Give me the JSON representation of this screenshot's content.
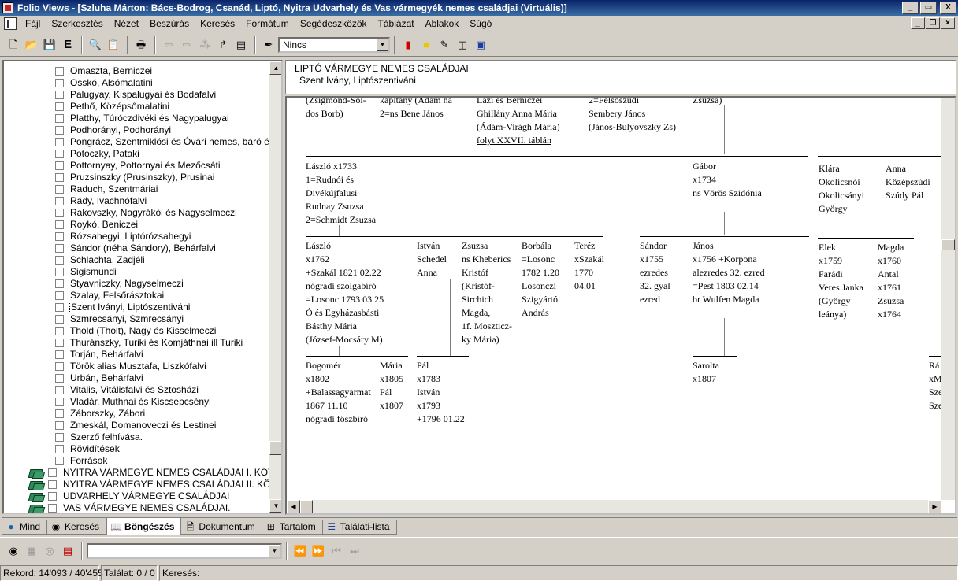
{
  "window": {
    "title": "Folio Views - [Szluha Márton: Bács-Bodrog, Csanád, Liptó, Nyitra Udvarhely és Vas vármegyék nemes családjai (Virtuális)]",
    "minimize": "_",
    "maximize": "▭",
    "close": "X"
  },
  "menu": [
    "Fájl",
    "Szerkesztés",
    "Nézet",
    "Beszúrás",
    "Keresés",
    "Formátum",
    "Segédeszközök",
    "Táblázat",
    "Ablakok",
    "Súgó"
  ],
  "toolbar": {
    "style_combo": "Nincs",
    "icons": [
      "new-doc-icon",
      "open-folder-icon",
      "save-icon",
      "edit-e-icon",
      "search-doc-icon",
      "query-icon",
      "print-icon",
      "back-arrow-icon",
      "forward-arrow-icon",
      "network-icon",
      "jump-icon",
      "object-icon",
      "bookmark-icon",
      "note-icon",
      "highlighter-icon",
      "split-view-icon",
      "window-icon"
    ]
  },
  "tree": {
    "items": [
      "Omaszta, Berniczei",
      "Osskó, Alsómalatini",
      "Palugyay, Kispalugyai és Bodafalvi",
      "Pethő, Középsőmalatini",
      "Platthy, Túróczdivéki és Nagypalugyai",
      "Podhorányi, Podhorányi",
      "Pongrácz, Szentmiklósi és Óvári nemes, báró é",
      "Potoczky, Pataki",
      "Pottornyay, Pottornyai és Mezőcsáti",
      "Pruzsinszky (Prusinszky), Prusinai",
      "Raduch, Szentmáriai",
      "Rády, Ivachnófalvi",
      "Rakovszky, Nagyrákói és Nagyselmeczi",
      "Roykó, Beniczei",
      "Rózsahegyi, Liptórózsahegyi",
      "Sándor (néha Sándory), Behárfalvi",
      "Schlachta, Zadjéli",
      "Sigismundi",
      "Styavniczky, Nagyselmeczi",
      "Szalay, Felsőrásztokai",
      "Szent Iványi, Liptószentiváni",
      "Szmrecsányi, Szmrecsányi",
      "Thold (Tholt), Nagy és Kisselmeczi",
      "Thuránszky, Turiki és Komjáthnai ill Turiki",
      "Torján, Behárfalvi",
      "Török alias Musztafa, Liszkófalvi",
      "Urbán, Behárfalvi",
      "Vitális, Vitálisfalvi és Sztosházi",
      "Vladár, Muthnai és Kiscsepcsényi",
      "Záborszky, Zábori",
      "Zmeskál, Domanoveczi és Lestinei",
      "Szerző felhívása.",
      "Rövidítések",
      "Források"
    ],
    "selected_index": 20,
    "volumes": [
      "NYITRA VÁRMEGYE NEMES CSALÁDJAI I. KÖTE",
      "NYITRA VÁRMEGYE NEMES CSALÁDJAI II. KÖTE",
      "UDVARHELY VÁRMEGYE CSALÁDJAI",
      "VAS VÁRMEGYE NEMES CSALÁDJAI."
    ]
  },
  "header": {
    "line1": "LIPTÓ VÁRMEGYE NEMES CSALÁDJAI",
    "line2": "Szent Ivány, Liptószentiváni"
  },
  "doc": {
    "top_cut": [
      [
        "(Zsigmond-Sol-",
        "dos Borb)"
      ],
      [
        "kapitány (Ádám ha",
        "2=ns Bene János"
      ],
      [
        "Lázi és Berniczei",
        "Ghillány Anna Mária",
        "(Ádám-Virágh Mária)",
        "folyt XXVII. táblán"
      ],
      [
        "2=Felsőszúdi",
        "Sembery János",
        "(János-Bulyovszky Zs)"
      ],
      [
        "Zsuzsa)"
      ]
    ],
    "gen2": [
      [
        "László x1733",
        "1=Rudnói és",
        "Divékújfalusi",
        "Rudnay Zsuzsa",
        "2=Schmidt Zsuzsa"
      ],
      [
        "Gábor",
        "x1734",
        "ns Vörös Szidónia"
      ],
      [
        "Klára",
        "Okolicsnói",
        "Okolicsányi",
        "György"
      ],
      [
        "Anna",
        "Középszúdi",
        "Szúdy Pál"
      ]
    ],
    "gen3": [
      [
        "László",
        "x1762",
        "+Szakál 1821 02.22",
        "nógrádi szolgabíró",
        "=Losonc 1793 03.25",
        "Ó és Egyházasbásti",
        "Básthy Mária",
        "(József-Mocsáry M)"
      ],
      [
        "István",
        "Schedel",
        "Anna"
      ],
      [
        "Zsuzsa",
        "ns Kheberics",
        "Kristóf",
        "(Kristóf-",
        "Sirchich",
        "Magda,",
        "1f. Moszticz-",
        "ky Mária)"
      ],
      [
        "Borbála",
        "=Losonc",
        "1782 1.20",
        "Losonczi",
        "Szigyártó",
        "András"
      ],
      [
        "Teréz",
        "xSzakál",
        "1770",
        "04.01"
      ],
      [
        "Sándor",
        "x1755",
        "ezredes",
        "32. gyal",
        "ezred"
      ],
      [
        "János",
        "x1756 +Korpona",
        "alezredes 32. ezred",
        "=Pest 1803 02.14",
        "br Wulfen Magda"
      ],
      [
        "Elek",
        "x1759",
        "Farádi",
        "Veres Janka",
        "(György",
        "leánya)"
      ],
      [
        "Magda",
        "x1760",
        "Antal",
        "x1761",
        "Zsuzsa",
        "x1764"
      ]
    ],
    "gen4": [
      [
        "Bogomér",
        "x1802",
        "+Balassagyarmat",
        "1867 11.10",
        "nógrádi főszbíró"
      ],
      [
        "Mária",
        "x1805",
        "Pál",
        "x1807"
      ],
      [
        "Pál",
        "x1783",
        "István",
        "x1793",
        "+1796 01.22"
      ],
      [
        "Sarolta",
        "x1807"
      ],
      [
        "Rá",
        "xM",
        "Sze",
        "Sze"
      ]
    ]
  },
  "tabs": [
    {
      "label": "Mind",
      "icon": "globe-icon"
    },
    {
      "label": "Keresés",
      "icon": "binoculars-icon"
    },
    {
      "label": "Böngészés",
      "icon": "book-icon"
    },
    {
      "label": "Dokumentum",
      "icon": "document-icon"
    },
    {
      "label": "Tartalom",
      "icon": "contents-icon"
    },
    {
      "label": "Találati-lista",
      "icon": "list-icon"
    }
  ],
  "active_tab": 2,
  "search": {
    "query_value": "",
    "icons": [
      "binoculars-icon",
      "query-form-icon",
      "binoculars-advanced-icon",
      "find-highlight-icon",
      "prev-hit-icon",
      "next-hit-icon",
      "prev-doc-icon",
      "next-doc-icon"
    ]
  },
  "status": {
    "record": "Rekord: 14'093 / 40'455",
    "hits": "Találat: 0 / 0",
    "search": "Keresés:"
  }
}
